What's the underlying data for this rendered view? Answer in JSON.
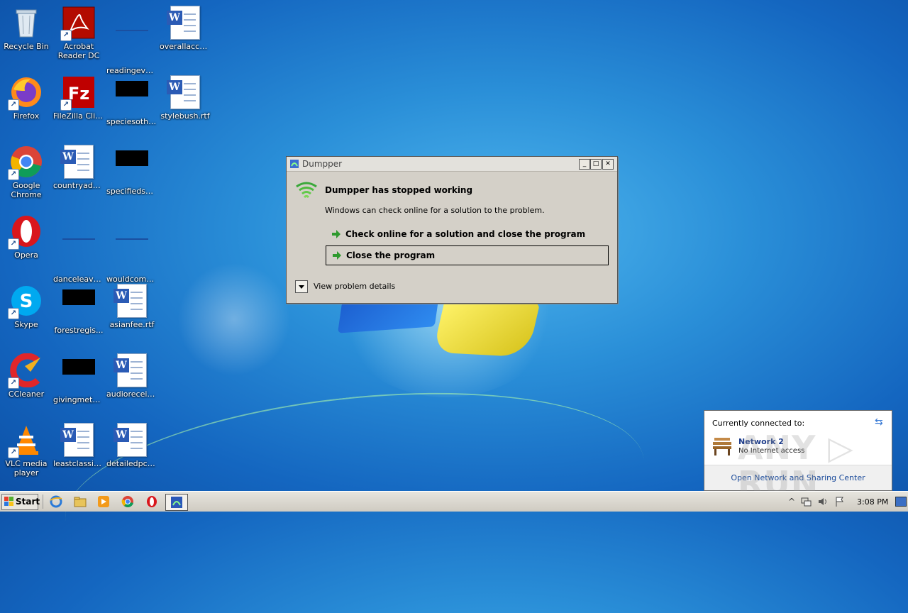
{
  "desktop": {
    "icons": [
      {
        "label": "Recycle Bin"
      },
      {
        "label": "Acrobat Reader DC"
      },
      {
        "label": "readingeve..."
      },
      {
        "label": "overallacco..."
      },
      {
        "label": "Firefox"
      },
      {
        "label": "FileZilla Client"
      },
      {
        "label": "speciesothe..."
      },
      {
        "label": "stylebush.rtf"
      },
      {
        "label": "Google Chrome"
      },
      {
        "label": "countryadd..."
      },
      {
        "label": "specifiedso..."
      },
      {
        "label": "Opera"
      },
      {
        "label": "danceleave...."
      },
      {
        "label": "wouldcompo..."
      },
      {
        "label": "Skype"
      },
      {
        "label": "forestregis..."
      },
      {
        "label": "asianfee.rtf"
      },
      {
        "label": "CCleaner"
      },
      {
        "label": "givingmeth..."
      },
      {
        "label": "audioreceiv..."
      },
      {
        "label": "VLC media player"
      },
      {
        "label": "leastclassic.rtf"
      },
      {
        "label": "detailedpc.rtf"
      }
    ]
  },
  "dialog": {
    "title": "Dumpper",
    "heading": "Dumpper has stopped working",
    "message": "Windows can check online for a solution to the problem.",
    "option_check_online": "Check online for a solution and close the program",
    "option_close": "Close the program",
    "details_label": "View problem details",
    "min_glyph": "_",
    "max_glyph": "□",
    "close_glyph": "✕"
  },
  "network_popup": {
    "header": "Currently connected to:",
    "network_name": "Network  2",
    "network_status": "No Internet access",
    "link": "Open Network and Sharing Center"
  },
  "watermark": {
    "text": "ANY ▷ RUN"
  },
  "taskbar": {
    "start_label": "Start",
    "clock": "3:08 PM"
  },
  "colors": {
    "accent_green": "#2e9a2e",
    "link_blue": "#1a4a9a",
    "desktop_blue": "#2a8fd8"
  }
}
